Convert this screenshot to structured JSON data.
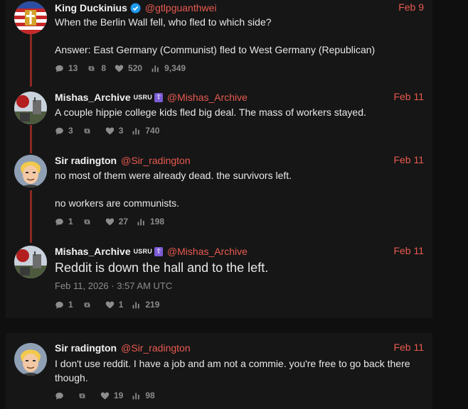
{
  "colors": {
    "accent": "#e85a4f",
    "muted": "#8c8c8c",
    "thread_line": "#8b2a24",
    "verified": "#1d9bf0",
    "badge_purple": "#7c5cd6"
  },
  "tweets": [
    {
      "avatar": "flag-cross-avatar",
      "fullname": "King Duckinius",
      "verified": true,
      "username": "@gtlpguanthwei",
      "date": "Feb 9",
      "paragraphs": [
        "When the Berlin Wall fell, who fled to which side?",
        "Answer: East Germany (Communist) fled to West Germany (Republican)"
      ],
      "stats": {
        "comments": "13",
        "retweets": "8",
        "likes": "520",
        "views": "9,349"
      }
    },
    {
      "avatar": "landscape-avatar",
      "fullname": "Mishas_Archive",
      "badge": "USRU",
      "badge_symbol": "☦",
      "username": "@Mishas_Archive",
      "date": "Feb 11",
      "paragraphs": [
        "A couple hippie college kids fled big deal. The mass of workers stayed."
      ],
      "stats": {
        "comments": "3",
        "retweets": "",
        "likes": "3",
        "views": "740"
      }
    },
    {
      "avatar": "cartoon-hero-avatar",
      "fullname": "Sir radington",
      "username": "@Sir_radington",
      "date": "Feb 11",
      "paragraphs": [
        "no most of them were already dead. the survivors left.",
        "no workers are communists."
      ],
      "stats": {
        "comments": "1",
        "retweets": "",
        "likes": "27",
        "views": "198"
      }
    },
    {
      "avatar": "landscape-avatar",
      "fullname": "Mishas_Archive",
      "badge": "USRU",
      "badge_symbol": "☦",
      "username": "@Mishas_Archive",
      "date": "Feb 11",
      "paragraphs": [
        "Reddit is down the hall and to the left."
      ],
      "timestamp": "Feb 11, 2026 · 3:57 AM UTC",
      "stats": {
        "comments": "1",
        "retweets": "",
        "likes": "1",
        "views": "219"
      }
    },
    {
      "avatar": "cartoon-hero-avatar",
      "fullname": "Sir radington",
      "username": "@Sir_radington",
      "date": "Feb 11",
      "paragraphs": [
        "I don't use reddit. I have a job and am not a commie. you're free to go back there though."
      ],
      "stats": {
        "comments": "",
        "retweets": "",
        "likes": "19",
        "views": "98"
      }
    }
  ]
}
